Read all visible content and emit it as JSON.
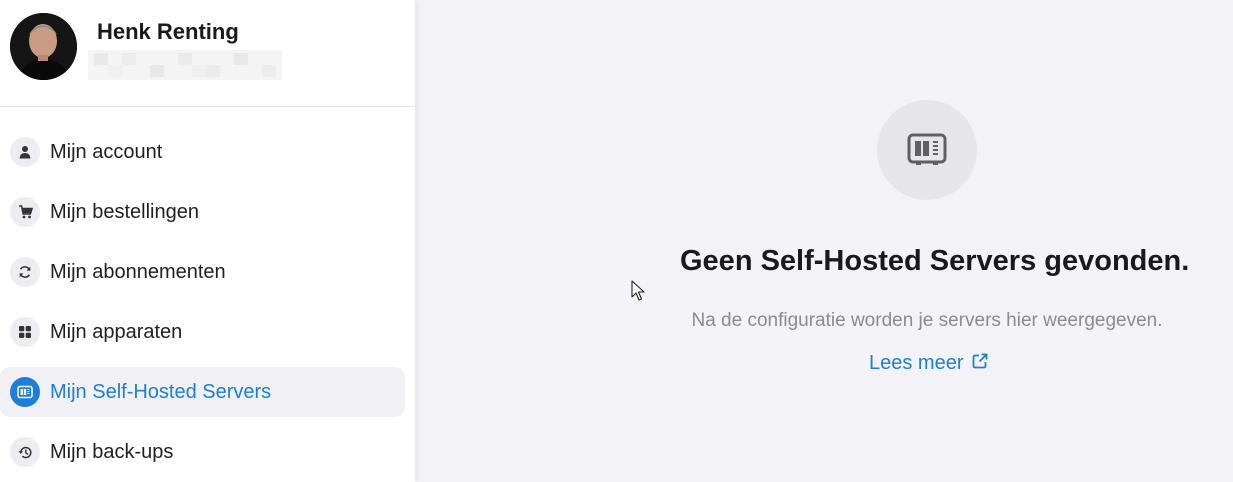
{
  "profile": {
    "name": "Henk Renting"
  },
  "nav": {
    "items": [
      {
        "label": "Mijn account",
        "icon": "user-icon"
      },
      {
        "label": "Mijn bestellingen",
        "icon": "cart-icon"
      },
      {
        "label": "Mijn abonnementen",
        "icon": "refresh-icon"
      },
      {
        "label": "Mijn apparaten",
        "icon": "grid-icon"
      },
      {
        "label": "Mijn Self-Hosted Servers",
        "icon": "server-icon",
        "active": true
      },
      {
        "label": "Mijn back-ups",
        "icon": "history-icon"
      }
    ]
  },
  "empty_state": {
    "icon": "server-icon",
    "title": "Geen Self-Hosted Servers gevonden.",
    "subtitle": "Na de configuratie worden je servers hier weergegeven.",
    "link_label": "Lees meer",
    "link_icon": "external-link-icon"
  },
  "colors": {
    "accent": "#1e7fd9",
    "background": "#f2f2f7",
    "sidebar": "#ffffff"
  }
}
